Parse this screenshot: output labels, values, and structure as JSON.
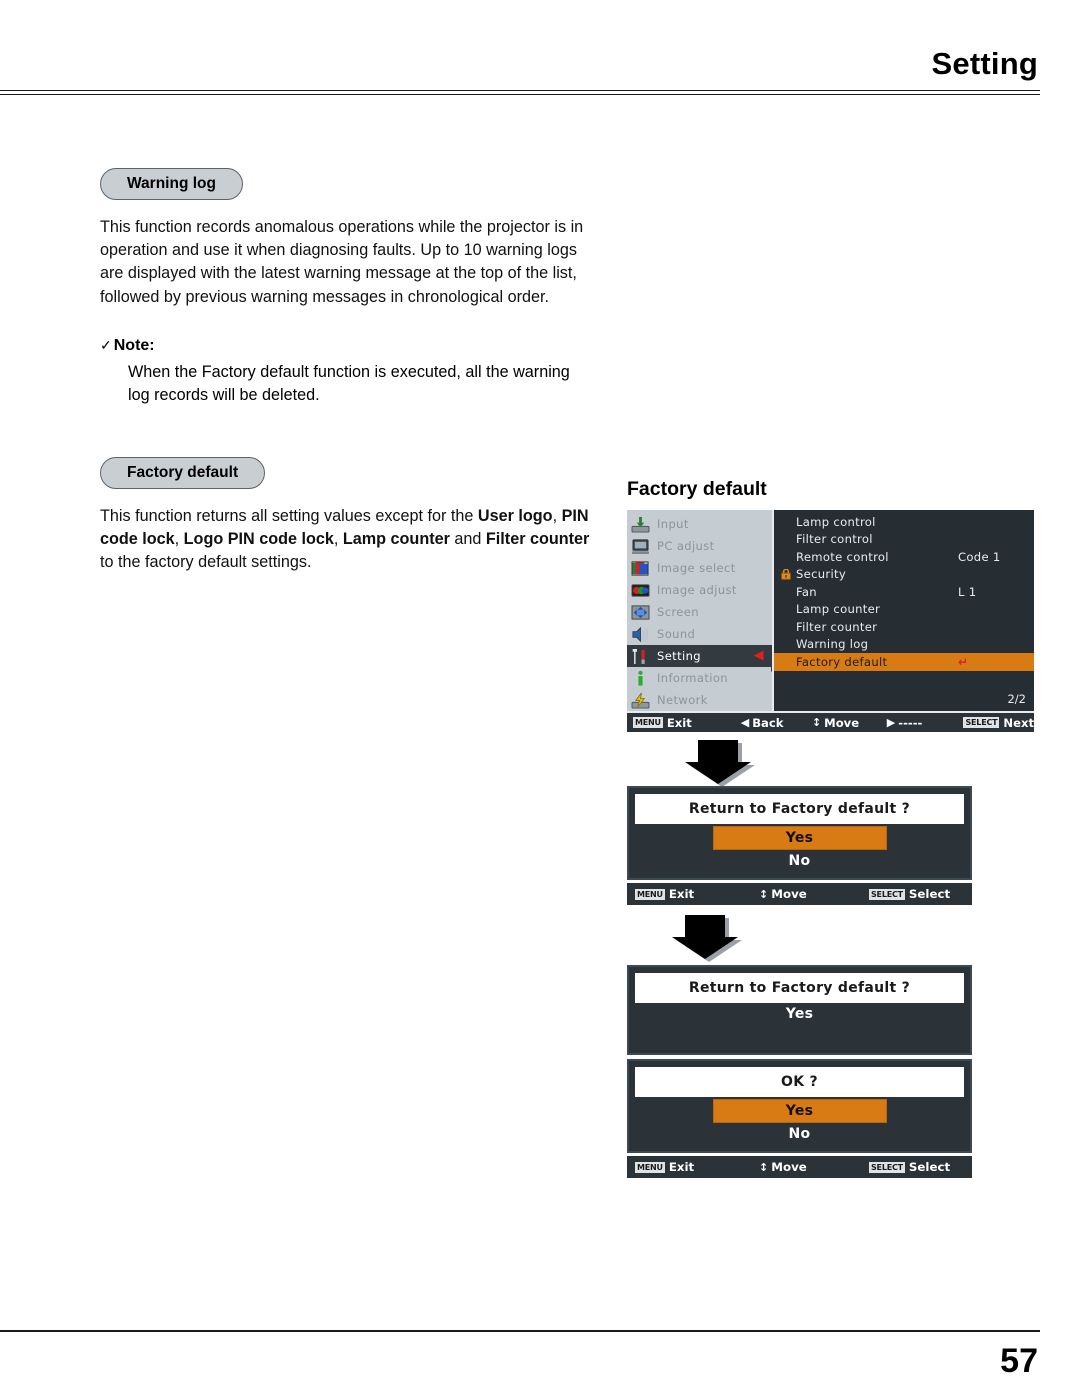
{
  "header": {
    "title": "Setting"
  },
  "footer": {
    "page_number": "57"
  },
  "sections": [
    {
      "pill": "Warning log",
      "paragraph": "This function records anomalous operations while the projector is in operation and use it when diagnosing faults. Up to 10 warning logs are displayed with the latest warning message at the top of the list, followed by previous warning messages in chronological order.",
      "note_label": "Note:",
      "note_check": "✓",
      "note_body": "When the Factory default function is executed, all the warning log records will be deleted."
    },
    {
      "pill": "Factory default",
      "para_1": "This function returns all setting values except for the ",
      "bold_1": "User logo",
      "para_2": ", ",
      "bold_2": "PIN code lock",
      "para_3": ", ",
      "bold_3": "Logo PIN code lock",
      "para_4": ", ",
      "bold_4": "Lamp counter",
      "para_5": " and ",
      "bold_5": "Filter counter",
      "para_6": " to the factory default settings."
    }
  ],
  "osd": {
    "caption": "Factory default",
    "sidebar": [
      {
        "label": "Input",
        "icon": "input-icon",
        "active": false
      },
      {
        "label": "PC adjust",
        "icon": "pc-adjust-icon",
        "active": false
      },
      {
        "label": "Image select",
        "icon": "image-select-icon",
        "active": false
      },
      {
        "label": "Image adjust",
        "icon": "image-adjust-icon",
        "active": false
      },
      {
        "label": "Screen",
        "icon": "screen-icon",
        "active": false
      },
      {
        "label": "Sound",
        "icon": "sound-icon",
        "active": false
      },
      {
        "label": "Setting",
        "icon": "setting-icon",
        "active": true,
        "caret": "◀"
      },
      {
        "label": "Information",
        "icon": "information-icon",
        "active": false
      },
      {
        "label": "Network",
        "icon": "network-icon",
        "active": false
      }
    ],
    "items": [
      {
        "label": "Lamp control",
        "value": "",
        "lock": false,
        "selected": false
      },
      {
        "label": "Filter control",
        "value": "",
        "lock": false,
        "selected": false
      },
      {
        "label": "Remote control",
        "value": "Code 1",
        "lock": false,
        "selected": false
      },
      {
        "label": "Security",
        "value": "",
        "lock": true,
        "selected": false
      },
      {
        "label": "Fan",
        "value": "L 1",
        "lock": false,
        "selected": false
      },
      {
        "label": "Lamp counter",
        "value": "",
        "lock": false,
        "selected": false
      },
      {
        "label": "Filter counter",
        "value": "",
        "lock": false,
        "selected": false
      },
      {
        "label": "Warning log",
        "value": "",
        "lock": false,
        "selected": false
      },
      {
        "label": "Factory default",
        "value": "",
        "lock": false,
        "selected": true,
        "return_glyph": "↵"
      }
    ],
    "page_indicator": "2/2",
    "status_bar": {
      "exit_key": "MENU",
      "exit_label": "Exit",
      "back_glyph": "◀",
      "back_label": "Back",
      "move_glyph": "↕",
      "move_label": "Move",
      "next_glyph": "▶",
      "next_dashes": "-----",
      "select_key": "SELECT",
      "select_label": "Next"
    }
  },
  "dialogs": {
    "first": {
      "question": "Return to Factory default ?",
      "yes": "Yes",
      "no": "No"
    },
    "second": {
      "question": "Return to Factory default ?",
      "yes": "Yes"
    },
    "third": {
      "question": "OK ?",
      "yes": "Yes",
      "no": "No"
    },
    "bar": {
      "exit_key": "MENU",
      "exit_label": "Exit",
      "move_glyph": "↕",
      "move_label": "Move",
      "select_key": "SELECT",
      "select_label": "Select"
    }
  },
  "colors": {
    "highlight_orange": "#d97b15",
    "osd_panel": "#262d33",
    "osd_sidebar": "#c6cdd2",
    "pill_fill": "#c9ced3",
    "caret_red": "#e02020"
  }
}
